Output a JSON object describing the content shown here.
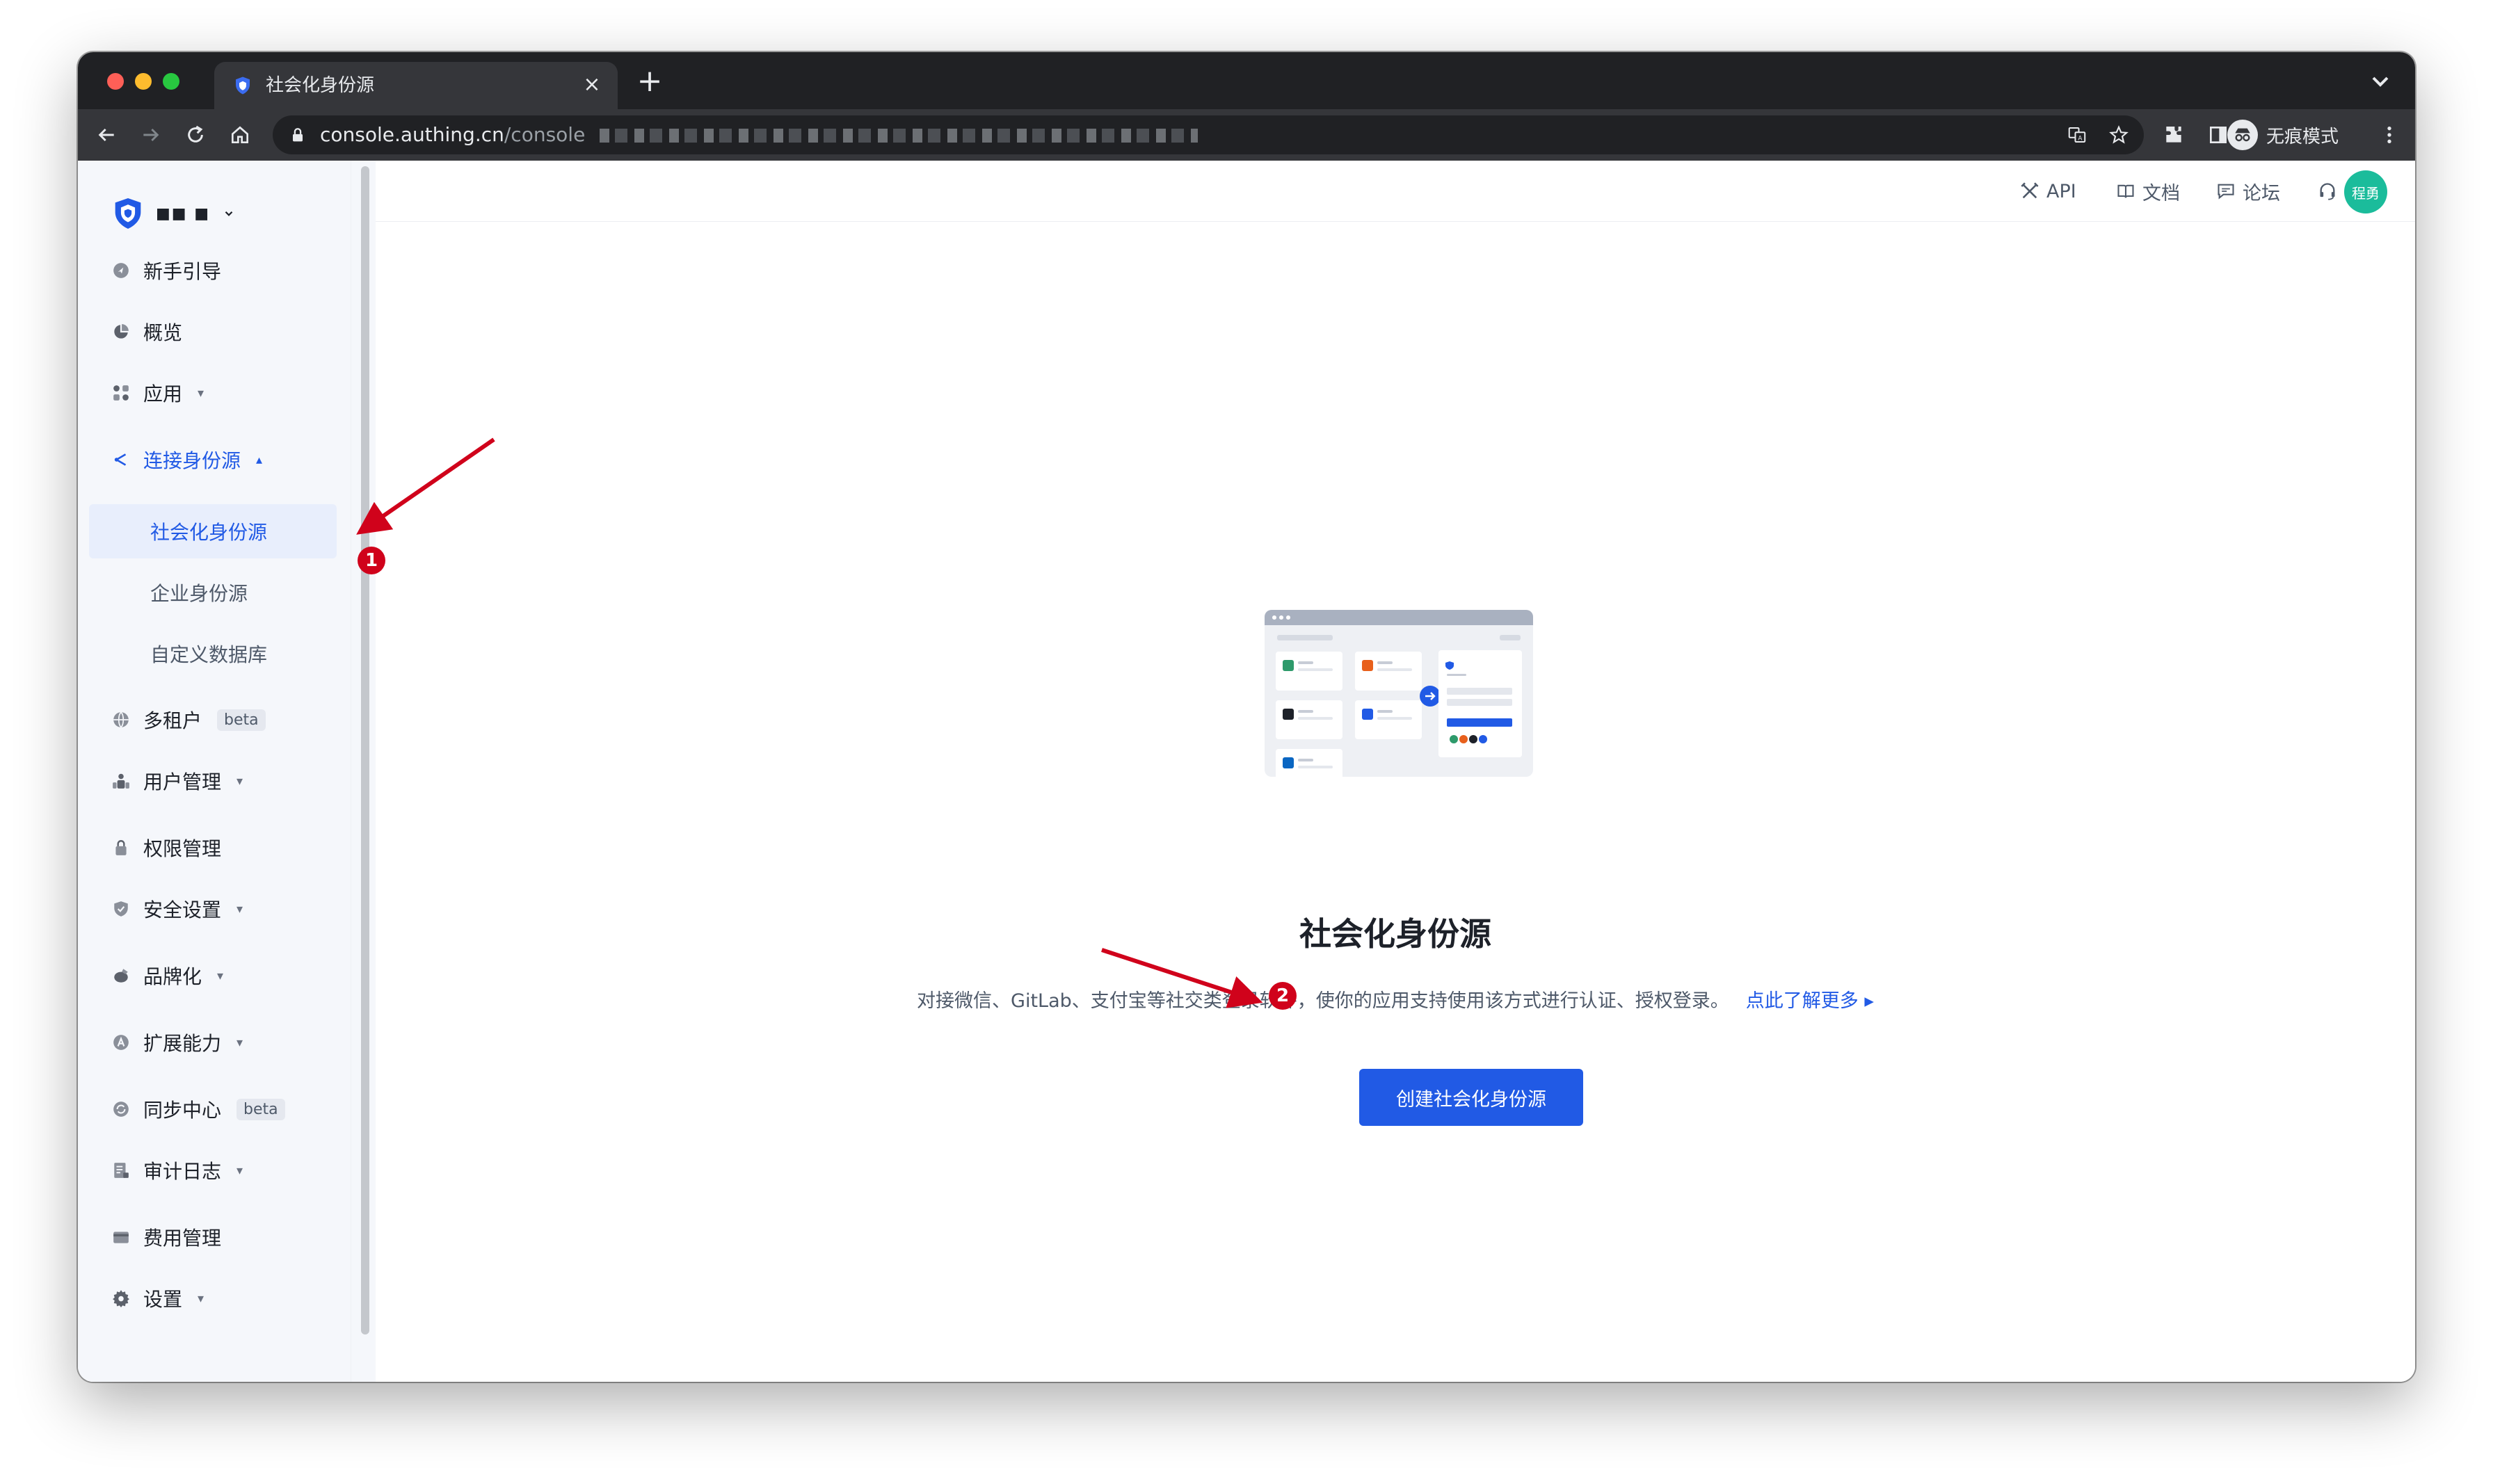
{
  "browser": {
    "tab_title": "社会化身份源",
    "url_host": "console.authing.cn",
    "url_path": "/console",
    "incognito_label": "无痕模式"
  },
  "sidebar": {
    "org_name": "■■ ■",
    "items": [
      {
        "label": "新手引导",
        "icon": "guide-icon"
      },
      {
        "label": "概览",
        "icon": "pie-chart-icon"
      },
      {
        "label": "应用",
        "icon": "apps-icon",
        "caret": "▾"
      },
      {
        "label": "连接身份源",
        "icon": "share-icon",
        "caret": "▴"
      },
      {
        "label": "多租户",
        "icon": "globe-icon",
        "badge": "beta"
      },
      {
        "label": "用户管理",
        "icon": "users-icon",
        "caret": "▾"
      },
      {
        "label": "权限管理",
        "icon": "lock-icon"
      },
      {
        "label": "安全设置",
        "icon": "shield-check-icon",
        "caret": "▾"
      },
      {
        "label": "品牌化",
        "icon": "brush-icon",
        "caret": "▾"
      },
      {
        "label": "扩展能力",
        "icon": "extension-icon",
        "caret": "▾"
      },
      {
        "label": "同步中心",
        "icon": "sync-icon",
        "badge": "beta"
      },
      {
        "label": "审计日志",
        "icon": "log-icon",
        "caret": "▾"
      },
      {
        "label": "费用管理",
        "icon": "wallet-icon"
      },
      {
        "label": "设置",
        "icon": "gear-icon",
        "caret": "▾"
      }
    ],
    "sub_items": [
      "社会化身份源",
      "企业身份源",
      "自定义数据库"
    ]
  },
  "header": {
    "api_label": "API",
    "docs_label": "文档",
    "forum_label": "论坛",
    "support_label": "客服",
    "avatar_text": "程勇"
  },
  "main": {
    "title": "社会化身份源",
    "description": "对接微信、GitLab、支付宝等社交类登录软件，使你的应用支持使用该方式进行认证、授权登录。",
    "learn_more": "点此了解更多 ▸",
    "create_button": "创建社会化身份源"
  },
  "annotations": {
    "marker_1": "1",
    "marker_2": "2",
    "arrow_color": "#d0021b"
  },
  "colors": {
    "accent": "#215ae5",
    "active_bg": "#e8eefc",
    "avatar_bg": "#1bbc9b"
  }
}
